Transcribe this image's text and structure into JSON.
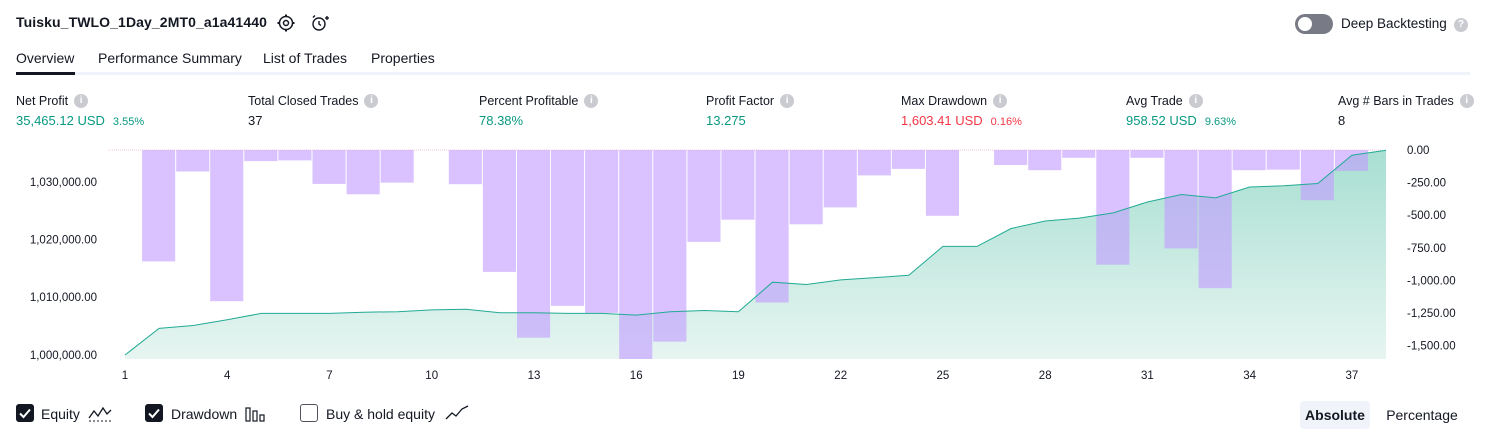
{
  "header": {
    "title": "Tuisku_TWLO_1Day_2MT0_a1a41440",
    "deep_backtesting_label": "Deep Backtesting",
    "deep_backtesting_on": false
  },
  "tabs": [
    {
      "label": "Overview",
      "active": true
    },
    {
      "label": "Performance Summary",
      "active": false
    },
    {
      "label": "List of Trades",
      "active": false
    },
    {
      "label": "Properties",
      "active": false
    }
  ],
  "stats": [
    {
      "label": "Net Profit",
      "value": "35,465.12 USD",
      "pct": "3.55%",
      "color": "green"
    },
    {
      "label": "Total Closed Trades",
      "value": "37",
      "pct": "",
      "color": "dark"
    },
    {
      "label": "Percent Profitable",
      "value": "78.38%",
      "pct": "",
      "color": "green"
    },
    {
      "label": "Profit Factor",
      "value": "13.275",
      "pct": "",
      "color": "green"
    },
    {
      "label": "Max Drawdown",
      "value": "1,603.41 USD",
      "pct": "0.16%",
      "color": "red"
    },
    {
      "label": "Avg Trade",
      "value": "958.52 USD",
      "pct": "9.63%",
      "color": "green"
    },
    {
      "label": "Avg # Bars in Trades",
      "value": "8",
      "pct": "",
      "color": "dark"
    }
  ],
  "legend": {
    "equity": {
      "label": "Equity",
      "checked": true
    },
    "drawdown": {
      "label": "Drawdown",
      "checked": true
    },
    "buy_hold": {
      "label": "Buy & hold equity",
      "checked": false
    }
  },
  "mode": {
    "absolute": "Absolute",
    "percentage": "Percentage",
    "selected": "Absolute"
  },
  "chart_data": {
    "type": "area",
    "x": [
      1,
      2,
      3,
      4,
      5,
      6,
      7,
      8,
      9,
      10,
      11,
      12,
      13,
      14,
      15,
      16,
      17,
      18,
      19,
      20,
      21,
      22,
      23,
      24,
      25,
      26,
      27,
      28,
      29,
      30,
      31,
      32,
      33,
      34,
      35,
      36,
      37,
      38
    ],
    "x_ticks": [
      "1",
      "4",
      "7",
      "10",
      "13",
      "16",
      "19",
      "22",
      "25",
      "28",
      "31",
      "34",
      "37"
    ],
    "left_axis_ticks": [
      "1,000,000.00",
      "1,010,000.00",
      "1,020,000.00",
      "1,030,000.00"
    ],
    "right_axis_ticks": [
      "0.00",
      "-250.00",
      "-500.00",
      "-750.00",
      "-1,000.00",
      "-1,250.00",
      "-1,500.00"
    ],
    "ylim_equity": [
      999300,
      1035500
    ],
    "ylim_drawdown": [
      -1603.41,
      0
    ],
    "series": [
      {
        "name": "Equity",
        "color": "#22ab94",
        "values": [
          1000000,
          1004600,
          1005100,
          1006100,
          1007200,
          1007200,
          1007200,
          1007400,
          1007500,
          1007800,
          1007900,
          1007300,
          1007300,
          1007200,
          1007200,
          1006900,
          1007500,
          1007700,
          1007500,
          1012600,
          1012200,
          1013000,
          1013400,
          1013800,
          1018800,
          1018800,
          1021900,
          1023200,
          1023700,
          1024600,
          1026500,
          1027800,
          1027200,
          1029100,
          1029300,
          1029700,
          1034600,
          1035465.12
        ]
      },
      {
        "name": "Drawdown",
        "color": "#c29cff",
        "values": [
          0,
          -855,
          -165,
          -1160,
          -85,
          -80,
          -260,
          -340,
          -250,
          0,
          -262,
          -935,
          -1440,
          -1195,
          -1250,
          -1603.41,
          -1470,
          -705,
          -535,
          -1170,
          -570,
          -440,
          -195,
          -145,
          -505,
          0,
          -115,
          -155,
          -60,
          -880,
          -60,
          -755,
          -1060,
          -155,
          -150,
          -385,
          -160,
          0
        ]
      }
    ]
  }
}
